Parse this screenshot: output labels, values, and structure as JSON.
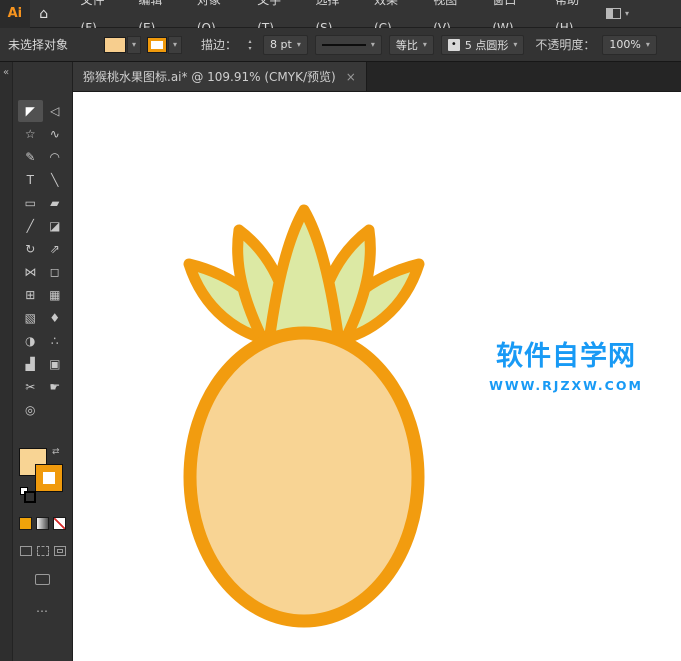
{
  "menubar": {
    "logo": "Ai",
    "home_icon": "⌂",
    "items": [
      {
        "name": "menu-file",
        "label": "文件(F)"
      },
      {
        "name": "menu-edit",
        "label": "编辑(E)"
      },
      {
        "name": "menu-object",
        "label": "对象(O)"
      },
      {
        "name": "menu-type",
        "label": "文字(T)"
      },
      {
        "name": "menu-select",
        "label": "选择(S)"
      },
      {
        "name": "menu-effect",
        "label": "效果(C)"
      },
      {
        "name": "menu-view",
        "label": "视图(V)"
      },
      {
        "name": "menu-window",
        "label": "窗口(W)"
      },
      {
        "name": "menu-help",
        "label": "帮助(H)"
      }
    ],
    "workspace_chevron": "▾"
  },
  "controlbar": {
    "selection_status": "未选择对象",
    "fill_color": "#F7CE8E",
    "stroke_color": "#F09A0C",
    "stroke_label": "描边：",
    "stepper_up": "▴",
    "stepper_down": "▾",
    "stroke_weight": "8 pt",
    "profile_label": "等比",
    "brush_dot": "•",
    "brush_label": "5 点圆形",
    "opacity_label": "不透明度：",
    "opacity_value": "100%",
    "chevron": "▾"
  },
  "tabbar": {
    "title": "猕猴桃水果图标.ai* @ 109.91% (CMYK/预览)",
    "close_icon": "×"
  },
  "toolbar": {
    "collapse_icon": "«",
    "swap_icon": "⇄",
    "ellipsis": "…",
    "tools": [
      {
        "name": "selection-tool",
        "glyph": "◤",
        "active": true
      },
      {
        "name": "direct-selection-tool",
        "glyph": "◁"
      },
      {
        "name": "magic-wand-tool",
        "glyph": "☆"
      },
      {
        "name": "lasso-tool",
        "glyph": "∿"
      },
      {
        "name": "pen-tool",
        "glyph": "✎"
      },
      {
        "name": "curvature-tool",
        "glyph": "◠"
      },
      {
        "name": "type-tool",
        "glyph": "T"
      },
      {
        "name": "line-segment-tool",
        "glyph": "╲"
      },
      {
        "name": "rectangle-tool",
        "glyph": "▭"
      },
      {
        "name": "paintbrush-tool",
        "glyph": "▰"
      },
      {
        "name": "pencil-tool",
        "glyph": "╱"
      },
      {
        "name": "eraser-tool",
        "glyph": "◪"
      },
      {
        "name": "rotate-tool",
        "glyph": "↻"
      },
      {
        "name": "scale-tool",
        "glyph": "⇗"
      },
      {
        "name": "width-tool",
        "glyph": "⋈"
      },
      {
        "name": "free-transform-tool",
        "glyph": "◻"
      },
      {
        "name": "perspective-grid-tool",
        "glyph": "⊞"
      },
      {
        "name": "mesh-tool",
        "glyph": "▦"
      },
      {
        "name": "gradient-tool",
        "glyph": "▧"
      },
      {
        "name": "eyedropper-tool",
        "glyph": "♦"
      },
      {
        "name": "blend-tool",
        "glyph": "◑"
      },
      {
        "name": "symbol-sprayer-tool",
        "glyph": "∴"
      },
      {
        "name": "column-graph-tool",
        "glyph": "▟"
      },
      {
        "name": "artboard-tool",
        "glyph": "▣"
      },
      {
        "name": "slice-tool",
        "glyph": "✂"
      },
      {
        "name": "hand-tool",
        "glyph": "☛"
      },
      {
        "name": "zoom-tool",
        "glyph": "◎"
      }
    ]
  },
  "artwork": {
    "body_fill": "#F8D494",
    "leaf_fill": "#DCE9A4",
    "outline": "#F29C0F"
  },
  "watermark": {
    "line1": "软件自学网",
    "line2": "WWW.RJZXW.COM",
    "color": "#189AF5"
  }
}
